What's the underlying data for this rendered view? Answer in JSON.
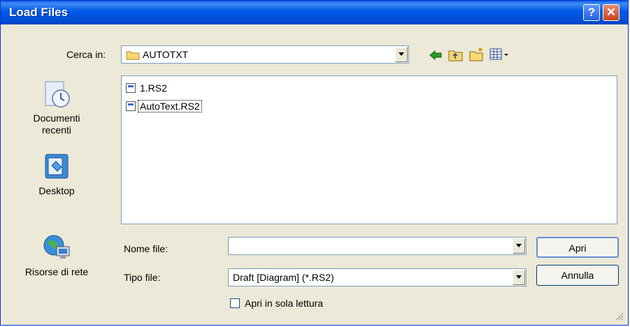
{
  "window": {
    "title": "Load Files",
    "help_glyph": "?",
    "close_glyph": "✕"
  },
  "lookin": {
    "label": "Cerca in:",
    "folder": "AUTOTXT"
  },
  "toolbar": {
    "icons": [
      "back-icon",
      "up-folder-icon",
      "new-folder-icon",
      "view-menu-icon"
    ]
  },
  "places": [
    {
      "label": "Documenti recenti",
      "icon": "recent-documents-icon"
    },
    {
      "label": "Desktop",
      "icon": "desktop-icon"
    },
    {
      "label": "Risorse di rete",
      "icon": "network-icon"
    }
  ],
  "files": [
    {
      "name": "1.RS2"
    },
    {
      "name": "AutoText.RS2"
    }
  ],
  "filename": {
    "label": "Nome file:",
    "value": ""
  },
  "filetype": {
    "label": "Tipo file:",
    "value": "Draft [Diagram]  (*.RS2)"
  },
  "readonly": {
    "label": "Apri in sola lettura",
    "checked": false
  },
  "buttons": {
    "open": "Apri",
    "cancel": "Annulla"
  },
  "colors": {
    "titlebar": "#0054e3",
    "dialog_bg": "#ece9d8",
    "border": "#7f9db9"
  }
}
